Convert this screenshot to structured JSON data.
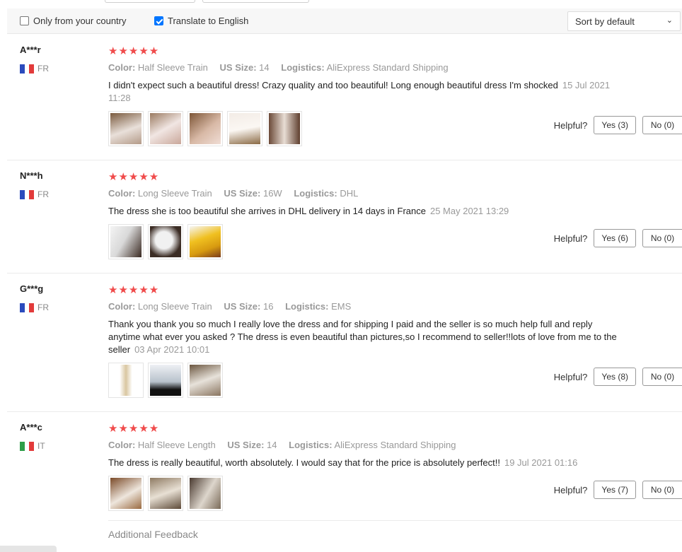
{
  "filters": {
    "only_country_label": "Only from your country",
    "only_country_checked": false,
    "translate_label": "Translate to English",
    "translate_checked": true,
    "sort_value": "Sort by default"
  },
  "labels": {
    "color": "Color:",
    "size": "US Size:",
    "logistics": "Logistics:",
    "helpful": "Helpful?",
    "additional_feedback": "Additional Feedback"
  },
  "reviews": [
    {
      "user": "A***r",
      "country": "FR",
      "stars": "★★★★★",
      "color": "Half Sleeve Train",
      "size": "14",
      "logistics": "AliExpress Standard Shipping",
      "text": "I didn't expect such a beautiful dress! Crazy quality and too beautiful! Long enough beautiful dress I'm shocked",
      "date": "15 Jul 2021 11:28",
      "yes": "Yes (3)",
      "no": "No (0)"
    },
    {
      "user": "N***h",
      "country": "FR",
      "stars": "★★★★★",
      "color": "Long Sleeve Train",
      "size": "16W",
      "logistics": "DHL",
      "text": "The dress she is too beautiful she arrives in DHL delivery in 14 days in France",
      "date": "25 May 2021 13:29",
      "yes": "Yes (6)",
      "no": "No (0)"
    },
    {
      "user": "G***g",
      "country": "FR",
      "stars": "★★★★★",
      "color": "Long Sleeve Train",
      "size": "16",
      "logistics": "EMS",
      "text": "Thank you thank you so much I really love the dress and for shipping I paid and the seller is so much help full and reply anytime what ever you asked ? The dress is even beautiful than pictures,so I recommend to seller!!lots of love from me to the seller",
      "date": "03 Apr 2021 10:01",
      "yes": "Yes (8)",
      "no": "No (0)"
    },
    {
      "user": "A***c",
      "country": "IT",
      "stars": "★★★★★",
      "color": "Half Sleeve Length",
      "size": "14",
      "logistics": "AliExpress Standard Shipping",
      "text": "The dress is really beautiful, worth absolutely. I would say that for the price is absolutely perfect!!",
      "date": "19 Jul 2021 01:16",
      "yes": "Yes (7)",
      "no": "No (0)"
    }
  ],
  "colors": {
    "star": "#f04b4b",
    "flag_fr": [
      "#2b4bbd",
      "#ffffff",
      "#e23b3b"
    ],
    "flag_it": [
      "#2e9e48",
      "#ffffff",
      "#e23b3b"
    ]
  }
}
